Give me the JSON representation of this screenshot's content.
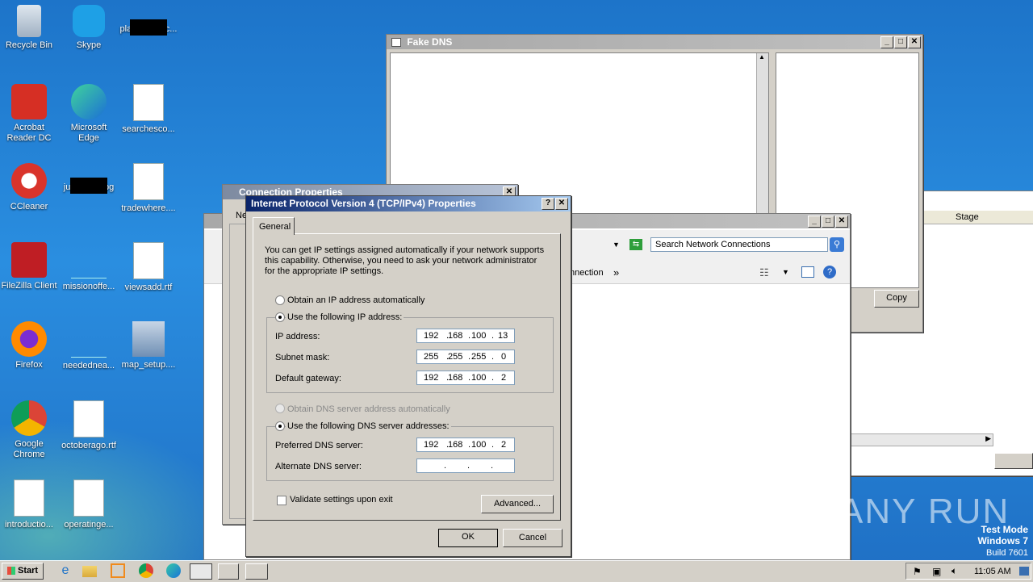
{
  "desktop": {
    "icons": [
      {
        "label": "Recycle Bin",
        "icon": "recycle-bin-icon"
      },
      {
        "label": "Skype",
        "icon": "skype-icon"
      },
      {
        "label": "planningbloc...",
        "icon": "image-thumb-icon"
      },
      {
        "label": "Acrobat Reader DC",
        "icon": "acrobat-icon"
      },
      {
        "label": "Microsoft Edge",
        "icon": "edge-icon"
      },
      {
        "label": "searchesco...",
        "icon": "word-doc-icon"
      },
      {
        "label": "CCleaner",
        "icon": "ccleaner-icon"
      },
      {
        "label": "junegoes.jpg",
        "icon": "image-thumb-icon"
      },
      {
        "label": "tradewhere....",
        "icon": "word-doc-icon"
      },
      {
        "label": "FileZilla Client",
        "icon": "filezilla-icon"
      },
      {
        "label": "missionoffe...",
        "icon": "blank-file-icon"
      },
      {
        "label": "viewsadd.rtf",
        "icon": "word-doc-icon"
      },
      {
        "label": "Firefox",
        "icon": "firefox-icon"
      },
      {
        "label": "neededneа...",
        "icon": "blank-file-icon"
      },
      {
        "label": "map_setup....",
        "icon": "installer-icon"
      },
      {
        "label": "Google Chrome",
        "icon": "chrome-icon"
      },
      {
        "label": "octoberago.rtf",
        "icon": "word-doc-icon"
      },
      {
        "label": "introductio...",
        "icon": "word-doc-icon"
      },
      {
        "label": "operatinge...",
        "icon": "word-doc-icon"
      }
    ],
    "watermark": {
      "brand": "ANY RUN",
      "line1": "Test Mode",
      "line2": "Windows 7",
      "line3": "Build 7601"
    }
  },
  "fake_dns": {
    "title": "Fake DNS",
    "copy_button": "Copy"
  },
  "back_window": {
    "column_stage": "Stage"
  },
  "conn_props": {
    "title": "Connection Properties",
    "tab_frag": "Ne"
  },
  "network_connections": {
    "search_placeholder": "Search Network Connections",
    "toolbar_fragment": "nnection",
    "more": "»"
  },
  "ipv4": {
    "title": "Internet Protocol Version 4 (TCP/IPv4) Properties",
    "help_btn": "?",
    "close_btn": "✕",
    "tab": "General",
    "intro": "You can get IP settings assigned automatically if your network supports this capability. Otherwise, you need to ask your network administrator for the appropriate IP settings.",
    "obtain_ip_auto": "Obtain an IP address automatically",
    "use_following_ip": "Use the following IP address:",
    "ip_label": "IP address:",
    "ip": [
      "192",
      "168",
      "100",
      "13"
    ],
    "subnet_label": "Subnet mask:",
    "subnet": [
      "255",
      "255",
      "255",
      "0"
    ],
    "gateway_label": "Default gateway:",
    "gateway": [
      "192",
      "168",
      "100",
      "2"
    ],
    "obtain_dns_auto": "Obtain DNS server address automatically",
    "use_following_dns": "Use the following DNS server addresses:",
    "pref_dns_label": "Preferred DNS server:",
    "pref_dns": [
      "192",
      "168",
      "100",
      "2"
    ],
    "alt_dns_label": "Alternate DNS server:",
    "alt_dns": [
      "",
      "",
      "",
      ""
    ],
    "validate": "Validate settings upon exit",
    "advanced": "Advanced...",
    "ok": "OK",
    "cancel": "Cancel"
  },
  "taskbar": {
    "start": "Start",
    "clock": "11:05 AM"
  }
}
